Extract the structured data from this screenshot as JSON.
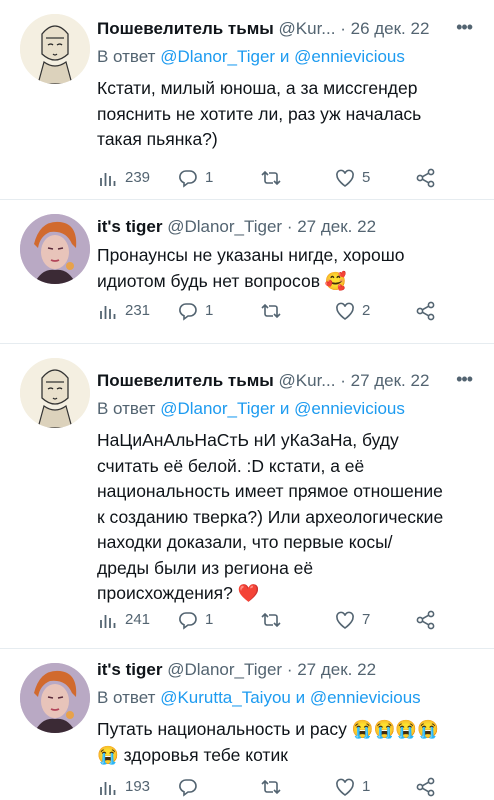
{
  "tweets": [
    {
      "name": "Пошевелитель тьмы",
      "handle": "@Kur...",
      "date": "26 дек. 22",
      "reply_prefix": "В ответ",
      "reply_mention_1": "@Dlanor_Tiger",
      "reply_and": "и",
      "reply_mention_2": "@ennievicious",
      "text": "Кстати, милый юноша, а за миссгендер\nпояснить не хотите ли, раз уж началась\nтакая пьянка?)",
      "views": "239",
      "replies": "1",
      "retweets": "",
      "likes": "5"
    },
    {
      "name": "it's tiger",
      "handle": "@Dlanor_Tiger",
      "date": "27 дек. 22",
      "text": "Пронаунсы не указаны нигде, хорошо\nидиотом будь нет вопросов 🥰",
      "views": "231",
      "replies": "1",
      "retweets": "",
      "likes": "2"
    },
    {
      "name": "Пошевелитель тьмы",
      "handle": "@Kur...",
      "date": "27 дек. 22",
      "reply_prefix": "В ответ",
      "reply_mention_1": "@Dlanor_Tiger",
      "reply_and": "и",
      "reply_mention_2": "@ennievicious",
      "text": "НаЦиАнАльНаСтЬ нИ уКаЗаНа, буду\nсчитать её белой. :D кстати, а её\nнациональность имеет прямое отношение\nк созданию тверка?) Или археологические\nнаходки доказали, что первые косы/\nдреды были из региона её\nпроисхождения? ❤️",
      "views": "241",
      "replies": "1",
      "retweets": "",
      "likes": "7"
    },
    {
      "name": "it's tiger",
      "handle": "@Dlanor_Tiger",
      "date": "27 дек. 22",
      "reply_prefix": "В ответ",
      "reply_mention_1": "@Kurutta_Taiyou",
      "reply_and": "и",
      "reply_mention_2": "@ennievicious",
      "text": "Путать национальность и расу 😭😭😭😭\n😭 здоровья тебе котик",
      "views": "193",
      "replies": "",
      "retweets": "",
      "likes": "1"
    }
  ],
  "more_icon": "more-dots-icon",
  "icons": [
    "views-icon",
    "reply-icon",
    "retweet-icon",
    "like-icon",
    "share-icon"
  ],
  "colors": {
    "text": "#0f1419",
    "secondary": "#536471",
    "link": "#1d9bf0",
    "divider": "#e6ecf0"
  }
}
